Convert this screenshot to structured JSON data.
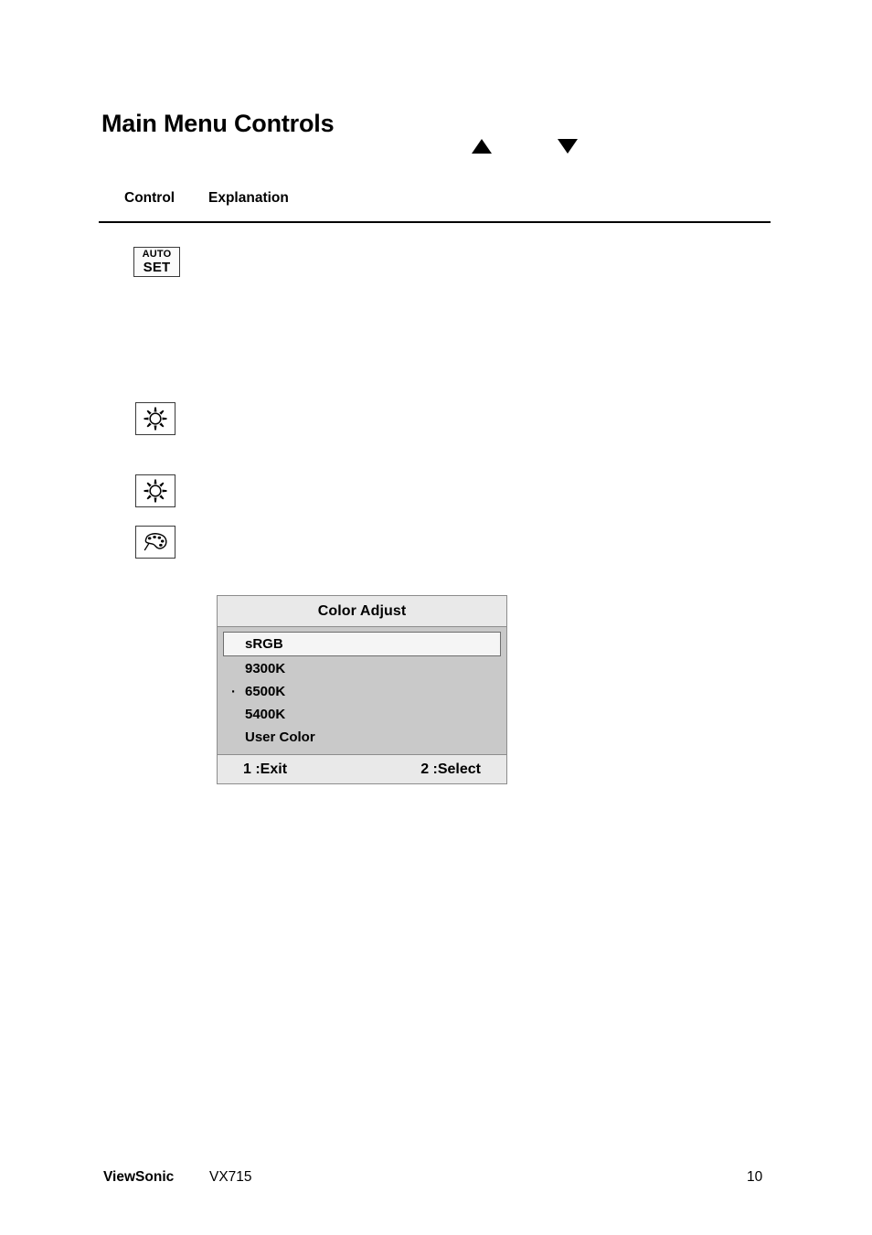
{
  "document": {
    "title": "Main Menu Controls"
  },
  "nav": {
    "up_arrow_icon": "triangle-up-icon",
    "down_arrow_icon": "triangle-down-icon"
  },
  "table": {
    "headers": {
      "control": "Control",
      "explanation": "Explanation"
    },
    "rows": [
      {
        "control_icon": "auto-set-button-icon",
        "icon_text": {
          "line1": "AUTO",
          "line2": "SET"
        },
        "explanation": ""
      },
      {
        "control_icon": "brightness-sun-icon",
        "explanation": ""
      },
      {
        "control_icon": "contrast-sun-icon",
        "explanation": ""
      },
      {
        "control_icon": "color-adjust-palette-icon",
        "explanation": ""
      }
    ]
  },
  "osd": {
    "title": "Color Adjust",
    "items": [
      {
        "label": "sRGB",
        "selected": true,
        "marker": ""
      },
      {
        "label": "9300K",
        "selected": false,
        "marker": ""
      },
      {
        "label": "6500K",
        "selected": false,
        "marker": "·"
      },
      {
        "label": "5400K",
        "selected": false,
        "marker": ""
      },
      {
        "label": "User Color",
        "selected": false,
        "marker": ""
      }
    ],
    "footer": {
      "exit": "1 :Exit",
      "select": "2 :Select"
    }
  },
  "footer": {
    "brand": "ViewSonic",
    "model": "VX715",
    "page_number": "10"
  },
  "colors": {
    "osd_header_bg": "#e9e9e9",
    "osd_body_bg": "#c9c9c9",
    "osd_selected_bg": "#f5f5f5",
    "osd_border": "#8c8c8c",
    "text": "#000000",
    "page_bg": "#ffffff"
  }
}
